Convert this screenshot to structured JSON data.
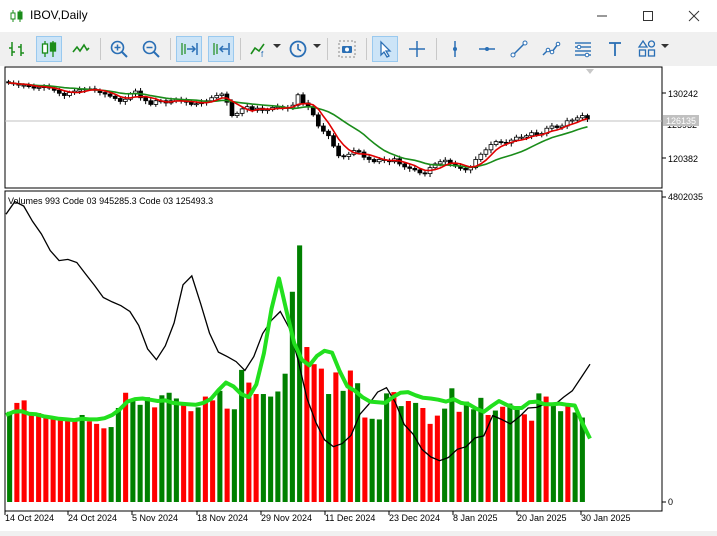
{
  "window": {
    "title": "IBOV,Daily"
  },
  "toolbar": {
    "items": [
      "new-order",
      "bar-chart",
      "candlestick-chart",
      "line-chart",
      "zoom-in",
      "zoom-out",
      "autoscroll",
      "chart-shift",
      "indicators",
      "periodicity",
      "screenshot",
      "cursor",
      "crosshair",
      "vertical-line",
      "horizontal-line",
      "trend-line",
      "equidistant-channel",
      "fibonacci",
      "text",
      "shapes"
    ]
  },
  "price_axis": {
    "labels": [
      "130242",
      "120382"
    ],
    "current_price": "126135",
    "current_price_sub": "125932"
  },
  "volume_panel": {
    "label": "Volumes 993 Code 03 945285.3 Code 03 125493.3",
    "axis_max": "4802035",
    "axis_min": "0"
  },
  "time_axis": {
    "labels": [
      "14 Oct 2024",
      "24 Oct 2024",
      "5 Nov 2024",
      "18 Nov 2024",
      "29 Nov 2024",
      "11 Dec 2024",
      "23 Dec 2024",
      "8 Jan 2025",
      "20 Jan 2025",
      "30 Jan 2025"
    ]
  },
  "colors": {
    "bull": "#008000",
    "bear": "#ff0000",
    "ma_fast": "#e00000",
    "ma_slow": "#1a8c1a",
    "volume_ma": "#22e01e",
    "black_line": "#000000"
  },
  "chart_data": [
    {
      "type": "candlestick",
      "title": "IBOV,Daily",
      "ylim": [
        117000,
        133000
      ],
      "close": [
        131000,
        130900,
        130700,
        130700,
        130500,
        130300,
        130400,
        130500,
        130300,
        130000,
        129600,
        129300,
        129700,
        129900,
        130100,
        130200,
        130200,
        130000,
        129700,
        129500,
        129200,
        128900,
        128500,
        128800,
        129500,
        129900,
        129000,
        128600,
        128100,
        128600,
        128600,
        128300,
        128600,
        128800,
        128600,
        128400,
        128100,
        128200,
        128400,
        128600,
        129000,
        129300,
        129500,
        128400,
        126600,
        126900,
        127500,
        127800,
        127300,
        127600,
        127300,
        127400,
        127700,
        127800,
        127700,
        127600,
        128000,
        129400,
        128300,
        127800,
        126700,
        125200,
        124500,
        123900,
        122500,
        121200,
        121100,
        121400,
        121900,
        121700,
        121000,
        120700,
        120400,
        120700,
        120600,
        120400,
        120800,
        120100,
        119700,
        119500,
        119300,
        118900,
        118800,
        119600,
        120100,
        120400,
        120600,
        120200,
        119800,
        119500,
        119300,
        119600,
        120700,
        121400,
        122000,
        122700,
        123100,
        123000,
        122900,
        123300,
        123700,
        123700,
        123900,
        124300,
        124000,
        124200,
        124900,
        125200,
        125000,
        125200,
        125900,
        126000,
        126300,
        126600,
        126135
      ],
      "ma_fast_label": "MA red",
      "ma_slow_label": "MA green"
    },
    {
      "type": "bar",
      "title": "Volumes 993 Code 03 945285.3 Code 03 125493.3",
      "ylim": [
        0,
        4802035
      ],
      "values": [
        1420000,
        1560000,
        1600000,
        1370000,
        1400000,
        1370000,
        1330000,
        1330000,
        1320000,
        1300000,
        1370000,
        1270000,
        1230000,
        1160000,
        1180000,
        1480000,
        1720000,
        1600000,
        1530000,
        1650000,
        1490000,
        1680000,
        1720000,
        1630000,
        1550000,
        1430000,
        1490000,
        1660000,
        1600000,
        1750000,
        1470000,
        1460000,
        2080000,
        1880000,
        1700000,
        1700000,
        1660000,
        1740000,
        2020000,
        3310000,
        4040000,
        2440000,
        2170000,
        2100000,
        1700000,
        2040000,
        1750000,
        2070000,
        1870000,
        1330000,
        1310000,
        1300000,
        1710000,
        1730000,
        1510000,
        1590000,
        1560000,
        1480000,
        1230000,
        1360000,
        1470000,
        1790000,
        1420000,
        1580000,
        1460000,
        1640000,
        1370000,
        1440000,
        1500000,
        1550000,
        1510000,
        1380000,
        1280000,
        1710000,
        1660000,
        1530000,
        1430000,
        1510000,
        1410000,
        1330000
      ],
      "directions": "UDDDDDDDDDUDDDUUDUUUDUUUDDUDDUDUUDDUUUUUUDDDUDUDUDUUUDUDUDDDUUDUUUDUDUUDDUDUUDUUU",
      "volume_ma": [
        1370000,
        1420000,
        1430000,
        1390000,
        1380000,
        1350000,
        1330000,
        1310000,
        1300000,
        1290000,
        1310000,
        1300000,
        1300000,
        1320000,
        1370000,
        1460000,
        1580000,
        1620000,
        1630000,
        1610000,
        1590000,
        1600000,
        1560000,
        1550000,
        1540000,
        1530000,
        1560000,
        1620000,
        1760000,
        1880000,
        1820000,
        1700000,
        1650000,
        1850000,
        2340000,
        3040000,
        3520000,
        3000000,
        2500000,
        2240000,
        2150000,
        2300000,
        2380000,
        2350000,
        2060000,
        1820000,
        1750000,
        1650000,
        1580000,
        1570000,
        1560000,
        1650000,
        1720000,
        1730000,
        1680000,
        1640000,
        1630000,
        1610000,
        1580000,
        1620000,
        1560000,
        1540000,
        1470000,
        1420000,
        1510000,
        1590000,
        1530000,
        1480000,
        1480000,
        1570000,
        1580000,
        1540000,
        1540000,
        1550000,
        1530000,
        1520000,
        1240000,
        1000000
      ],
      "black_line": [
        4530000,
        4730000,
        4660000,
        4420000,
        4220000,
        3960000,
        3800000,
        3820000,
        3770000,
        3590000,
        3410000,
        3220000,
        3150000,
        3090000,
        3000000,
        2780000,
        2410000,
        2240000,
        2460000,
        2820000,
        3420000,
        3560000,
        3120000,
        2660000,
        2360000,
        2290000,
        2210000,
        2070000,
        2290000,
        2650000,
        2860000,
        3000000,
        2740000,
        2240000,
        1640000,
        1260000,
        980000,
        870000,
        920000,
        1050000,
        1380000,
        1540000,
        1730000,
        1800000,
        1570000,
        1220000,
        1070000,
        830000,
        710000,
        650000,
        700000,
        830000,
        870000,
        1010000,
        1040000,
        1360000,
        1300000,
        1230000,
        1340000,
        1480000,
        1490000,
        1550000,
        1530000,
        1650000,
        1750000,
        1960000,
        2170000
      ]
    }
  ]
}
